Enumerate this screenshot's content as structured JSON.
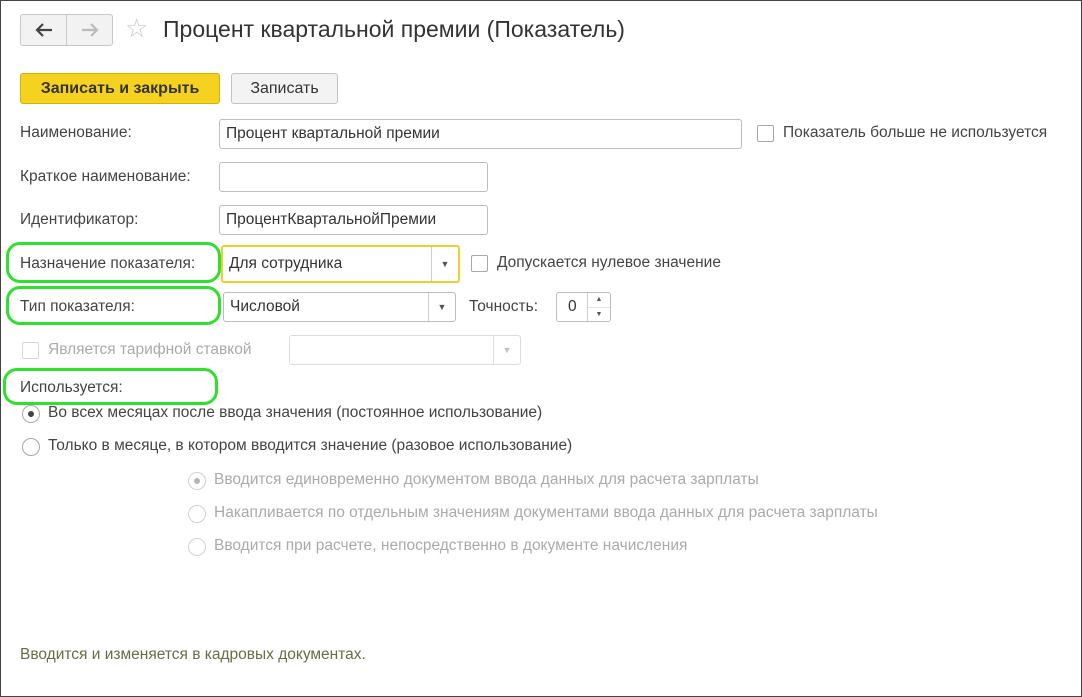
{
  "window": {
    "title": "Процент квартальной премии (Показатель)",
    "nav_back_icon": "arrow-left-icon",
    "nav_forward_icon": "arrow-right-icon",
    "favorite_icon": "star-icon"
  },
  "toolbar": {
    "save_close_label": "Записать и закрыть",
    "save_label": "Записать"
  },
  "fields": {
    "name_label": "Наименование:",
    "name_value": "Процент квартальной премии",
    "not_used_label": "Показатель больше не используется",
    "short_name_label": "Краткое наименование:",
    "short_name_value": "",
    "identifier_label": "Идентификатор:",
    "identifier_value": "ПроцентКвартальнойПремии",
    "purpose_label": "Назначение показателя:",
    "purpose_value": "Для сотрудника",
    "zero_allowed_label": "Допускается нулевое значение",
    "type_label": "Тип показателя:",
    "type_value": "Числовой",
    "precision_label": "Точность:",
    "precision_value": "0",
    "tariff_label": "Является тарифной ставкой",
    "tariff_value": ""
  },
  "usage": {
    "title": "Используется:",
    "options": [
      "Во всех месяцах после ввода значения (постоянное использование)",
      "Только в месяце, в котором вводится значение (разовое использование)"
    ],
    "sub_options": [
      "Вводится единовременно документом ввода данных для расчета зарплаты",
      "Накапливается по отдельным значениям документами ввода данных для расчета зарплаты",
      "Вводится при расчете, непосредственно в документе начисления"
    ]
  },
  "footer": {
    "note": "Вводится и изменяется в кадровых документах."
  },
  "colors": {
    "primary_button": "#f5d21f",
    "focus_border": "#f2cd2d",
    "highlight": "#2fe02f",
    "footer_text": "#6b6b45"
  }
}
